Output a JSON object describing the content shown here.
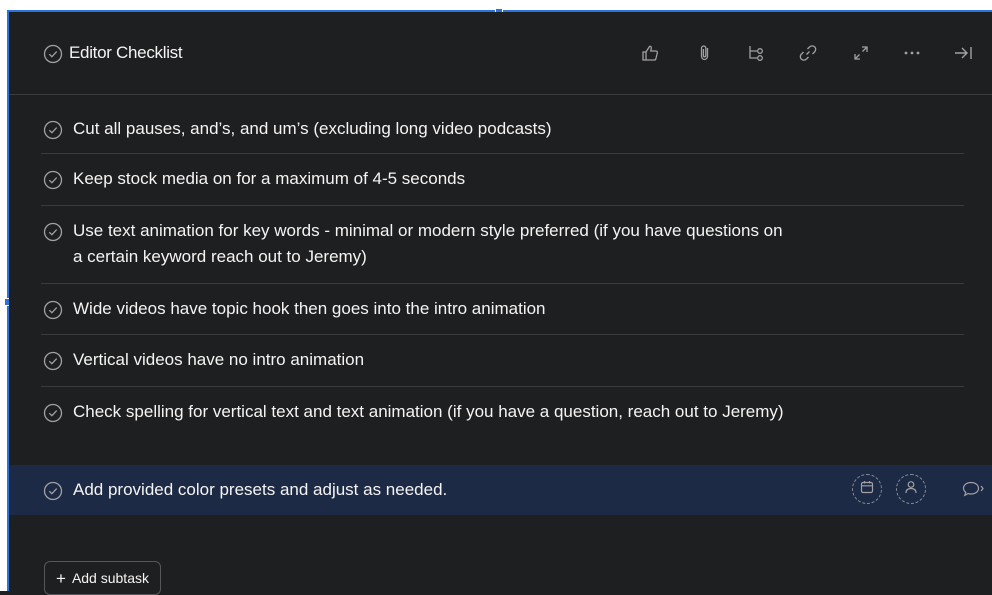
{
  "header": {
    "title": "Editor Checklist",
    "icons": [
      "check-circle-icon",
      "thumbs-up-icon",
      "attachment-icon",
      "subtask-icon",
      "link-icon",
      "expand-icon",
      "more-icon",
      "close-panel-icon"
    ]
  },
  "subtasks": [
    {
      "text": "Cut all pauses, and’s, and um’s (excluding long video podcasts)"
    },
    {
      "text": "Keep stock media on for a maximum of 4-5 seconds"
    },
    {
      "text": "Use text animation for key words - minimal or modern style preferred (if you have questions on a certain keyword reach out to Jeremy)"
    },
    {
      "text": "Wide videos have topic hook then goes into the intro animation"
    },
    {
      "text": "Vertical videos have no intro animation"
    },
    {
      "text": "Check spelling for vertical text and text animation (if you have a question, reach out to Jeremy)"
    },
    {
      "text": "Add provided color presets and adjust as needed."
    }
  ],
  "add_subtask": {
    "label": "Add subtask"
  },
  "colors": {
    "background": "#1e1f21",
    "selected_row": "#1d2a45",
    "selection_border": "#2d72d9"
  }
}
